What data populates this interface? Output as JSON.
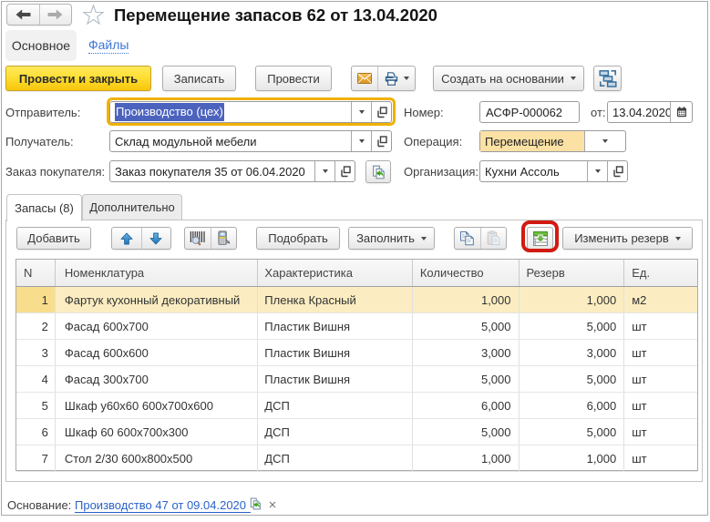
{
  "window": {
    "title": "Перемещение запасов 62 от 13.04.2020"
  },
  "nav_tabs": {
    "main": "Основное",
    "files": "Файлы"
  },
  "toolbar": {
    "post_and_close": "Провести и закрыть",
    "save": "Записать",
    "post": "Провести",
    "create_based_on": "Создать на основании"
  },
  "fields": {
    "sender": {
      "label": "Отправитель:",
      "value": "Производство (цех)"
    },
    "receiver": {
      "label": "Получатель:",
      "value": "Склад модульной мебели"
    },
    "customer_order": {
      "label": "Заказ покупателя:",
      "value": "Заказ покупателя 35 от 06.04.2020"
    },
    "number": {
      "label": "Номер:",
      "value": "АСФР-000062"
    },
    "date": {
      "label": "от:",
      "value": "13.04.2020"
    },
    "operation": {
      "label": "Операция:",
      "value": "Перемещение"
    },
    "organization": {
      "label": "Организация:",
      "value": "Кухни Ассоль"
    }
  },
  "page_tabs": {
    "stock": "Запасы (8)",
    "additional": "Дополнительно"
  },
  "table_toolbar": {
    "add": "Добавить",
    "pick": "Подобрать",
    "fill": "Заполнить",
    "change_reserve": "Изменить резерв"
  },
  "table": {
    "headers": [
      "N",
      "Номенклатура",
      "Характеристика",
      "Количество",
      "Резерв",
      "Ед."
    ],
    "rows": [
      [
        "1",
        "Фартук кухонный декоративный",
        "Пленка Красный",
        "1,000",
        "1,000",
        "м2"
      ],
      [
        "2",
        "Фасад 600х700",
        "Пластик Вишня",
        "5,000",
        "5,000",
        "шт"
      ],
      [
        "3",
        "Фасад 600х600",
        "Пластик Вишня",
        "3,000",
        "3,000",
        "шт"
      ],
      [
        "4",
        "Фасад 300х700",
        "Пластик Вишня",
        "5,000",
        "5,000",
        "шт"
      ],
      [
        "5",
        "Шкаф у60х60 600х700х600",
        "ДСП",
        "6,000",
        "6,000",
        "шт"
      ],
      [
        "6",
        "Шкаф 60 600х700х300",
        "ДСП",
        "5,000",
        "5,000",
        "шт"
      ],
      [
        "7",
        "Стол 2/30 600х800х500",
        "ДСП",
        "1,000",
        "1,000",
        "шт"
      ]
    ]
  },
  "footer": {
    "label": "Основание:",
    "link": "Производство 47 от 09.04.2020"
  },
  "colors": {
    "accent_yellow": "#f6c60b",
    "focus_frame": "#f0b103",
    "selection_blue": "#4c63be",
    "row_highlight": "#fbedc1",
    "annotation_red": "#d11a12",
    "operation_field": "#fbe1a4",
    "link_blue": "#2a62c8"
  }
}
